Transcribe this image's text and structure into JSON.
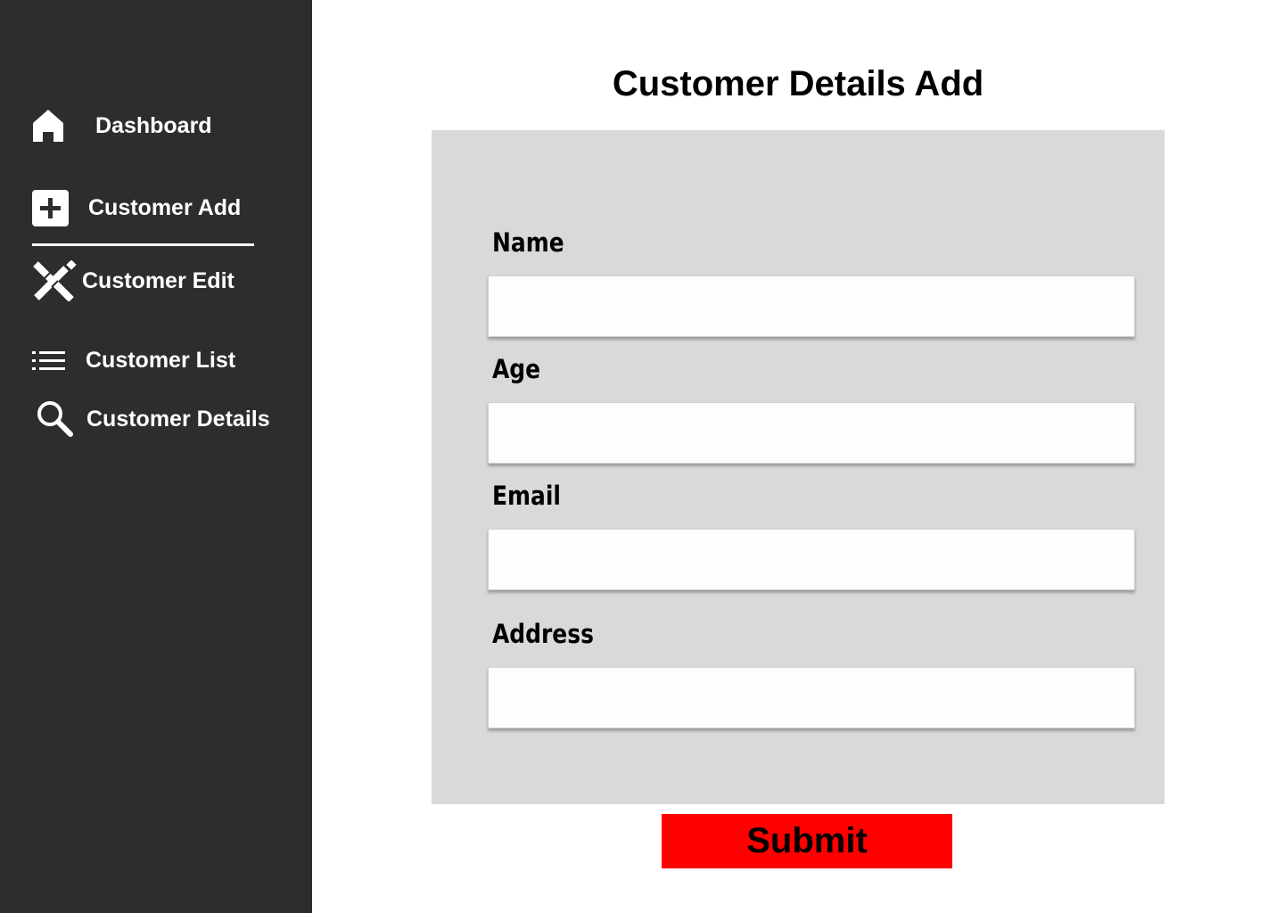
{
  "sidebar": {
    "items": [
      {
        "id": "dashboard",
        "label": "Dashboard",
        "icon": "home-icon"
      },
      {
        "id": "customer-add",
        "label": "Customer Add",
        "icon": "plus-square-icon",
        "active": true
      },
      {
        "id": "customer-edit",
        "label": "Customer Edit",
        "icon": "pencil-ruler-icon"
      },
      {
        "id": "customer-list",
        "label": "Customer List",
        "icon": "list-icon"
      },
      {
        "id": "customer-details",
        "label": "Customer Details",
        "icon": "search-icon"
      }
    ]
  },
  "main": {
    "title": "Customer Details Add",
    "form": {
      "fields": [
        {
          "label": "Name",
          "value": "",
          "placeholder": ""
        },
        {
          "label": "Age",
          "value": "",
          "placeholder": ""
        },
        {
          "label": "Email",
          "value": "",
          "placeholder": ""
        },
        {
          "label": "Address",
          "value": "",
          "placeholder": ""
        }
      ],
      "submit_label": "Submit"
    }
  },
  "colors": {
    "sidebar_bg": "#2d2d2d",
    "panel_bg": "#d9d9d9",
    "submit_bg": "#ff0000",
    "input_bg": "#fffcfd"
  }
}
